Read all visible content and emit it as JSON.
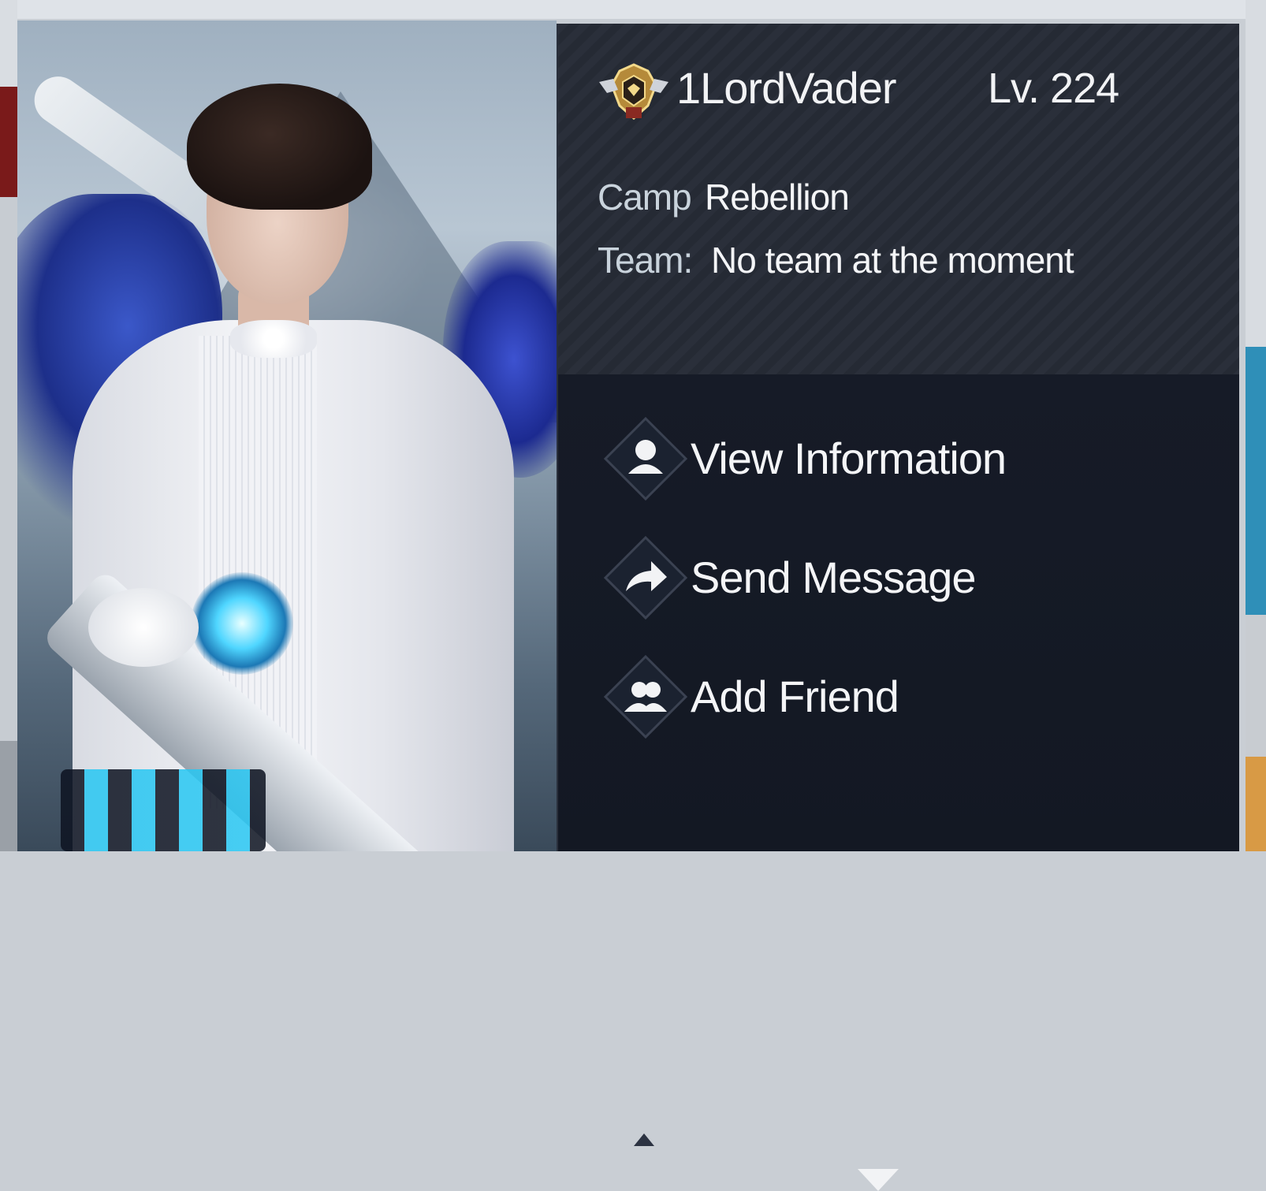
{
  "player": {
    "name": "1LordVader",
    "level": "Lv. 224",
    "rank_badge_icon": "gold-rank-badge-icon",
    "camp_label": "Camp",
    "camp_value": "Rebellion",
    "team_label": "Team:",
    "team_value": "No team at the moment"
  },
  "menu": {
    "items": [
      {
        "label": "View Information",
        "icon": "person-icon"
      },
      {
        "label": "Send Message",
        "icon": "share-arrow-icon"
      },
      {
        "label": "Add Friend",
        "icon": "friends-icon"
      }
    ],
    "scroll_icon": "chevron-down-icon"
  },
  "colors": {
    "panel_top": "#252a34",
    "panel_bottom": "#151a25",
    "text": "#f2f3f5",
    "label": "#c9d3dc",
    "badge_gold": "#d8b25a"
  }
}
